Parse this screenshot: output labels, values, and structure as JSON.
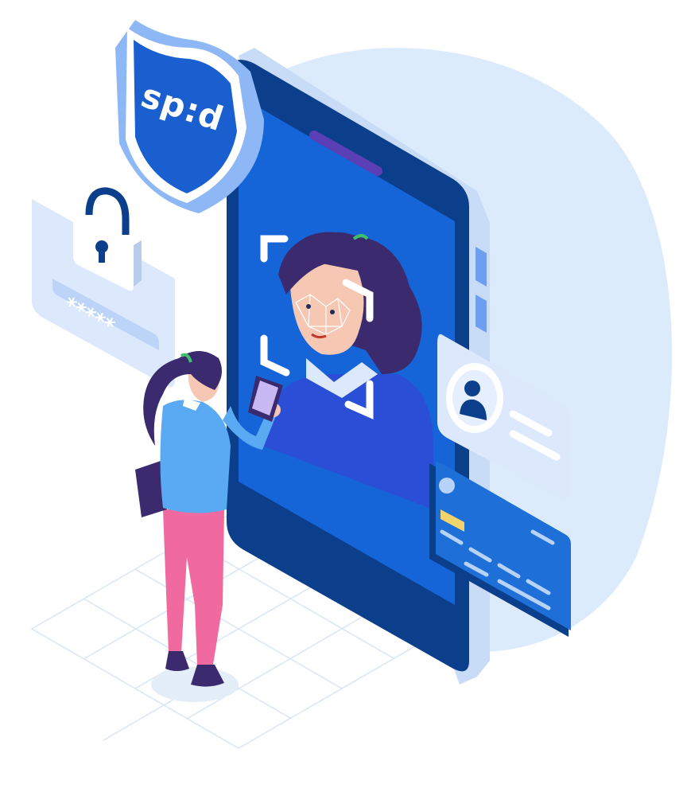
{
  "logo": {
    "text": "sp:d"
  },
  "password": {
    "masked_value": "*****"
  },
  "colors": {
    "blob": "#dcebfb",
    "phone_body": "#0b3f8c",
    "phone_screen": "#1565d8",
    "phone_frame": "#c9dcf7",
    "shield_outer": "#8db7f5",
    "shield_inner": "#1a5fd0",
    "person_hair": "#3b2b6e",
    "person_shirt": "#5aa9f3",
    "person_pants": "#f06a9f",
    "card_blue": "#1e6fd8",
    "card_chip": "#f3d36b"
  },
  "icons": {
    "shield": "shield-icon",
    "padlock": "padlock-icon",
    "user": "user-icon",
    "credit_card": "credit-card-icon",
    "face_scan": "face-scan-icon",
    "smartphone": "smartphone-icon"
  }
}
